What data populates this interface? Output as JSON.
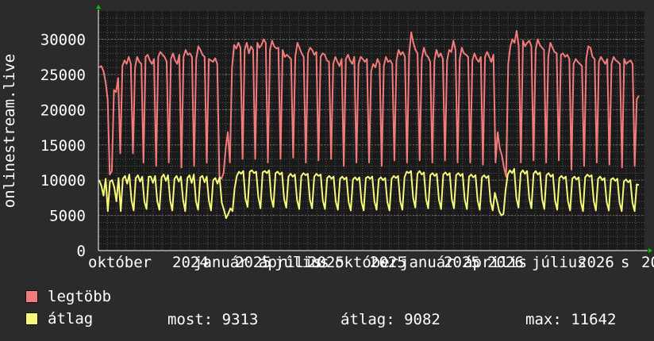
{
  "chart_data": {
    "type": "line",
    "ylabel": "onlinestream.live",
    "ylim": [
      0,
      34000
    ],
    "yticks": [
      0,
      5000,
      10000,
      15000,
      20000,
      25000,
      30000
    ],
    "x_tick_labels": [
      "október",
      "2024",
      "január",
      "2025",
      "április",
      "július",
      "2025",
      "október",
      "2025",
      "január",
      "2025",
      "április",
      "2026",
      "július",
      "2026",
      "s",
      "20"
    ],
    "grid": true,
    "colors": {
      "background": "#2b2b2b",
      "plot": "#1a1a1a",
      "grid": "#555555",
      "legtobb": "#f47b7b",
      "atlag": "#f8f87a",
      "axis_arrow": "#00cc00"
    },
    "series": [
      {
        "name": "legtöbb",
        "color": "#f47b7b",
        "values": [
          26000,
          26200,
          25500,
          24000,
          21500,
          10800,
          11300,
          22800,
          22500,
          24500,
          13800,
          26200,
          27000,
          26500,
          27500,
          26500,
          13800,
          26000,
          27500,
          26800,
          26500,
          12500,
          27500,
          27800,
          27000,
          26500,
          27200,
          12000,
          27500,
          28200,
          27800,
          27500,
          26800,
          12500,
          27200,
          28000,
          27000,
          26500,
          27800,
          11800,
          27500,
          28500,
          27800,
          28000,
          27500,
          12000,
          27200,
          29000,
          28500,
          27800,
          27500,
          12500,
          27200,
          27000,
          26800,
          27300,
          26500,
          10500,
          10200,
          11000,
          14500,
          16800,
          12500,
          26000,
          29200,
          28700,
          29500,
          28800,
          13000,
          28500,
          29500,
          28000,
          29000,
          28500,
          13000,
          29500,
          28800,
          29200,
          30000,
          29500,
          12500,
          28500,
          29800,
          29000,
          28700,
          28800,
          13000,
          28500,
          27500,
          27800,
          27500,
          27200,
          13200,
          27500,
          29500,
          28800,
          28000,
          27500,
          12500,
          28000,
          28800,
          28500,
          27800,
          28200,
          12800,
          27500,
          28000,
          27800,
          27000,
          26800,
          13000,
          26500,
          27500,
          26800,
          26200,
          27200,
          12000,
          27200,
          27800,
          27000,
          26500,
          27500,
          12500,
          26500,
          27500,
          27200,
          26800,
          27200,
          12500,
          25500,
          26500,
          26000,
          27200,
          26500,
          12000,
          26200,
          27500,
          26800,
          27000,
          26500,
          12800,
          27000,
          28500,
          27800,
          28200,
          27500,
          12500,
          27800,
          31000,
          29500,
          28500,
          28000,
          12800,
          27200,
          28800,
          27800,
          27500,
          26800,
          12500,
          27000,
          28500,
          27500,
          28000,
          27200,
          12800,
          27000,
          28500,
          28200,
          29800,
          28500,
          12500,
          27200,
          28800,
          28000,
          27800,
          27500,
          12500,
          27000,
          28000,
          27200,
          26800,
          27500,
          12200,
          27500,
          28200,
          27500,
          26800,
          27800,
          12500,
          16800,
          14500,
          13500,
          11800,
          10500,
          26500,
          29000,
          30000,
          29500,
          31200,
          29000,
          12500,
          29800,
          29000,
          29500,
          29800,
          29000,
          12800,
          28500,
          30000,
          29200,
          28800,
          28500,
          12500,
          27500,
          29500,
          28800,
          28200,
          28000,
          12800,
          27800,
          28000,
          27500,
          27800,
          27200,
          11500,
          26500,
          27200,
          26800,
          26500,
          26200,
          12000,
          27200,
          29000,
          28800,
          27500,
          27200,
          12500,
          26800,
          27500,
          27000,
          26500,
          27200,
          12200,
          26500,
          27500,
          27000,
          26800,
          26500,
          11800,
          27200,
          26500,
          26800,
          27000,
          26500,
          12000,
          21500,
          22000
        ]
      },
      {
        "name": "átlag",
        "color": "#f8f87a",
        "values": [
          10000,
          9200,
          7800,
          10200,
          5600,
          9800,
          10000,
          9000,
          7000,
          10300,
          5600,
          10200,
          10600,
          9500,
          10800,
          7200,
          5700,
          10300,
          10700,
          9800,
          10500,
          7000,
          5900,
          10500,
          10500,
          9600,
          10600,
          7000,
          5800,
          10400,
          10800,
          9900,
          10700,
          7100,
          5700,
          10200,
          10600,
          9800,
          10500,
          7200,
          5600,
          10300,
          10700,
          9600,
          10800,
          7000,
          5800,
          10400,
          10600,
          9700,
          10500,
          7100,
          5700,
          10000,
          10300,
          9500,
          10400,
          6800,
          5800,
          4600,
          5200,
          6000,
          5600,
          8900,
          10600,
          11200,
          10900,
          11300,
          7400,
          6200,
          11200,
          11400,
          11000,
          11200,
          7600,
          6000,
          11100,
          11300,
          11000,
          11400,
          7500,
          6200,
          11000,
          11200,
          10800,
          11100,
          7300,
          6100,
          10500,
          10900,
          10500,
          10800,
          7200,
          5900,
          10600,
          11000,
          10700,
          10900,
          7200,
          6000,
          10500,
          10900,
          10600,
          10800,
          7100,
          5900,
          10300,
          10600,
          10200,
          10500,
          7000,
          5800,
          10200,
          10500,
          10100,
          10400,
          6900,
          5700,
          10100,
          10400,
          10000,
          10400,
          6900,
          5700,
          10300,
          10500,
          10200,
          10500,
          7000,
          5800,
          10100,
          10400,
          10000,
          10300,
          6900,
          5700,
          10200,
          10600,
          10300,
          10600,
          7000,
          5800,
          10400,
          11200,
          11000,
          11300,
          7500,
          6100,
          10900,
          11300,
          10800,
          11100,
          7300,
          6000,
          10700,
          11000,
          10600,
          10900,
          7200,
          5900,
          10800,
          11100,
          10700,
          11000,
          7300,
          6000,
          10700,
          11000,
          10600,
          10900,
          7200,
          5900,
          10500,
          10800,
          10400,
          10700,
          7100,
          5800,
          10400,
          10700,
          10300,
          10600,
          7000,
          5700,
          8200,
          7000,
          5600,
          5000,
          5200,
          8600,
          10800,
          11400,
          11000,
          11600,
          7500,
          6100,
          11000,
          11400,
          10900,
          11300,
          7400,
          6000,
          10900,
          11300,
          10800,
          11100,
          7300,
          5900,
          10700,
          11000,
          10500,
          10800,
          7100,
          5800,
          10300,
          10600,
          10200,
          10500,
          7000,
          5700,
          10200,
          10500,
          10100,
          10400,
          6900,
          5600,
          10400,
          10800,
          10500,
          10700,
          7000,
          5700,
          10200,
          10500,
          10000,
          10300,
          6900,
          5700,
          10100,
          10300,
          9900,
          10200,
          6800,
          5600,
          9800,
          10100,
          9700,
          10000,
          6800,
          5600,
          9400,
          9300
        ]
      }
    ],
    "legend": [
      {
        "label": "legtöbb",
        "color": "#f47b7b"
      },
      {
        "label": "átlag",
        "color": "#f8f87a"
      }
    ],
    "stats": {
      "most": "most: 9313",
      "atlag": "átlag: 9082",
      "max": "max: 11642"
    }
  }
}
